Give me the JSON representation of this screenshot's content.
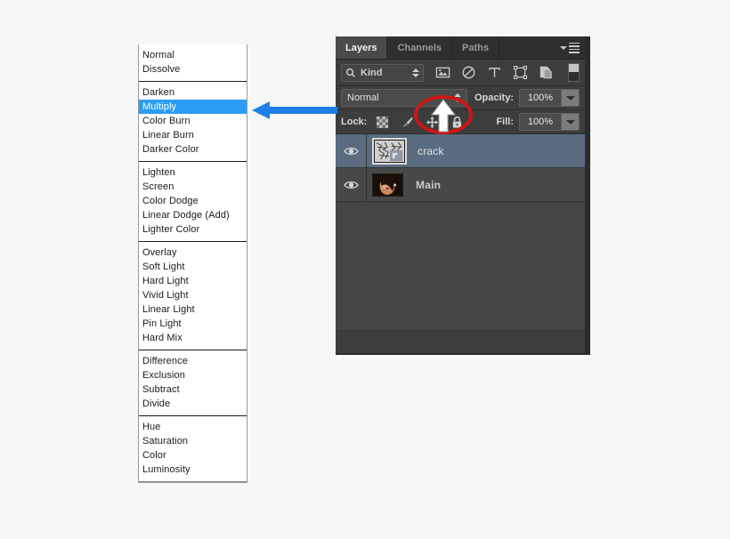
{
  "blend_mode_menu": {
    "name": "blending-mode-dropdown-list",
    "selected": "Multiply",
    "groups": [
      {
        "items": [
          "Normal",
          "Dissolve"
        ]
      },
      {
        "items": [
          "Darken",
          "Multiply",
          "Color Burn",
          "Linear Burn",
          "Darker Color"
        ]
      },
      {
        "items": [
          "Lighten",
          "Screen",
          "Color Dodge",
          "Linear Dodge (Add)",
          "Lighter Color"
        ]
      },
      {
        "items": [
          "Overlay",
          "Soft Light",
          "Hard Light",
          "Vivid Light",
          "Linear Light",
          "Pin Light",
          "Hard Mix"
        ]
      },
      {
        "items": [
          "Difference",
          "Exclusion",
          "Subtract",
          "Divide"
        ]
      },
      {
        "items": [
          "Hue",
          "Saturation",
          "Color",
          "Luminosity"
        ]
      }
    ]
  },
  "layers_panel": {
    "tabs": [
      {
        "label": "Layers",
        "active": true
      },
      {
        "label": "Channels",
        "active": false
      },
      {
        "label": "Paths",
        "active": false
      }
    ],
    "panel_menu_icon": "panel-menu-icon",
    "filter": {
      "kind_label": "Kind",
      "search_icon": "search-icon",
      "icons": [
        "pixel-layer-filter-icon",
        "adjustment-layer-filter-icon",
        "type-layer-filter-icon",
        "shape-layer-filter-icon",
        "smart-object-filter-icon"
      ],
      "toggle_icon": "filter-enable-toggle"
    },
    "blend_mode": "Normal",
    "opacity_label": "Opacity:",
    "opacity_value": "100%",
    "fill_label": "Fill:",
    "fill_value": "100%",
    "lock_label": "Lock:",
    "lock_icons": [
      "lock-transparent-pixels-icon",
      "lock-image-pixels-icon",
      "lock-position-icon",
      "lock-all-icon"
    ],
    "layers": [
      {
        "name": "crack",
        "selected": true,
        "visible": true,
        "thumbnail": "crackle-texture-thumbnail"
      },
      {
        "name": "Main",
        "selected": false,
        "visible": true,
        "thumbnail": "portrait-photo-thumbnail"
      }
    ]
  },
  "annotations": {
    "blue_arrow": {
      "name": "blue-pointer-arrow",
      "direction": "left",
      "color": "#1f7fe8"
    },
    "red_ellipse": {
      "name": "red-highlight-ellipse",
      "color": "#cc1717"
    },
    "white_arrow": {
      "name": "white-pointer-arrow",
      "direction": "up",
      "color": "#ffffff"
    }
  },
  "colors": {
    "highlight_blue": "#2a9df4",
    "panel_bg": "#3d3d3d",
    "layer_selected": "#5b6c80",
    "annotation_red": "#cc1717",
    "annotation_blue": "#1f7fe8"
  }
}
